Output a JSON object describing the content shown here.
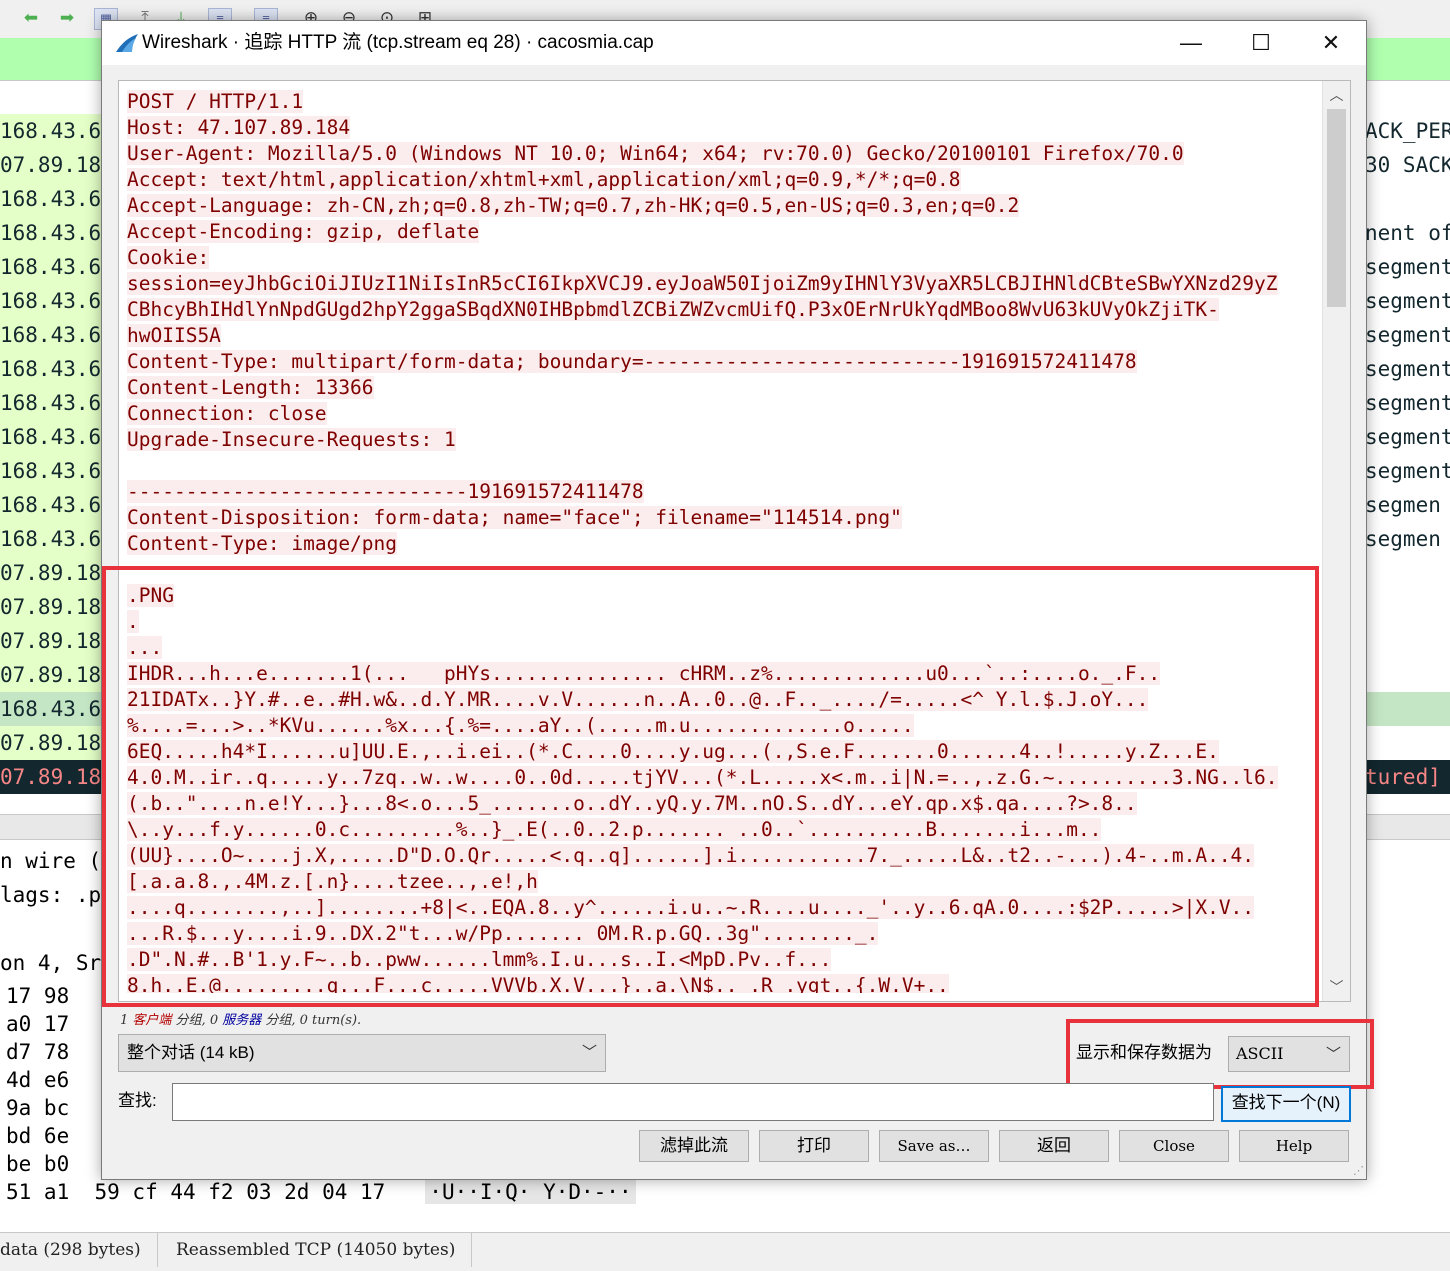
{
  "background": {
    "left_rows": [
      "168.43.6",
      "07.89.18",
      "168.43.6",
      "168.43.6",
      "168.43.6",
      "168.43.6",
      "168.43.6",
      "168.43.6",
      "168.43.6",
      "168.43.6",
      "168.43.6",
      "168.43.6",
      "168.43.6",
      "07.89.18",
      "07.89.18",
      "07.89.18",
      "07.89.18",
      "168.43.6",
      "07.89.18",
      "07.89.18"
    ],
    "right_rows": [
      "ACK_PER",
      "30 SACK",
      "",
      "nent of",
      "segment",
      "segment",
      "segment",
      "segment",
      "segment",
      "segment",
      "segment",
      "segmen",
      "segmen",
      "",
      "",
      "",
      "",
      "",
      "",
      "tured]"
    ],
    "details": [
      "n wire (",
      "lags: .p",
      "",
      "on 4, Sr"
    ],
    "bytes_left": [
      "17 98",
      "a0 17",
      "d7 78",
      "4d e6",
      "9a bc",
      "bd 6e",
      "be b0"
    ],
    "bytes_bottom_hex": "51 a1  59 cf 44 f2 03 2d 04 17",
    "bytes_bottom_ascii": "·U··I·Q· Y·D·-··",
    "status_frame": "data (298 bytes)",
    "status_reassembled": "Reassembled TCP (14050 bytes)"
  },
  "dialog": {
    "title": "Wireshark · 追踪 HTTP 流 (tcp.stream eq 28) · cacosmia.cap",
    "stream_lines": [
      "POST / HTTP/1.1",
      "Host: 47.107.89.184",
      "User-Agent: Mozilla/5.0 (Windows NT 10.0; Win64; x64; rv:70.0) Gecko/20100101 Firefox/70.0",
      "Accept: text/html,application/xhtml+xml,application/xml;q=0.9,*/*;q=0.8",
      "Accept-Language: zh-CN,zh;q=0.8,zh-TW;q=0.7,zh-HK;q=0.5,en-US;q=0.3,en;q=0.2",
      "Accept-Encoding: gzip, deflate",
      "Cookie:",
      "session=eyJhbGciOiJIUzI1NiIsInR5cCI6IkpXVCJ9.eyJoaW50IjoiZm9yIHNlY3VyaXR5LCBJIHNldCBteSBwYXNzd29yZ",
      "CBhcyBhIHdlYnNpdGUgd2hpY2ggaSBqdXN0IHBpbmdlZCBiZWZvcmUifQ.P3xOErNrUkYqdMBoo8WvU63kUVyOkZjiTK-",
      "hwOIIS5A",
      "Content-Type: multipart/form-data; boundary=---------------------------191691572411478",
      "Content-Length: 13366",
      "Connection: close",
      "Upgrade-Insecure-Requests: 1",
      "",
      "-----------------------------191691572411478",
      "Content-Disposition: form-data; name=\"face\"; filename=\"114514.png\"",
      "Content-Type: image/png",
      "",
      ".PNG",
      ".",
      "...",
      "IHDR...h...e.......1(...   pHYs............... cHRM..z%.............u0...`..:....o._.F..",
      "21IDATx..}Y.#..e..#H.w&..d.Y.MR....v.V......n..A..0..@..F.._..../=.....<^ Y.l.$.J.oY...",
      "%....=...>..*KVu......%x...{.%=....aY..(.....m.u.............o.....",
      "6EQ.....h4*I......u]UU.E.,..i.ei..(*.C....0....y.ug...(.,S.e.F.......0......4..!.....y.Z...E.",
      "4.0.M..ir..q.....y..7zq..w..w....0..0d.....tjYV...(*.L.....x<.m..i|N.=..,.z.G.~..........3.NG..l6.",
      "(.b..\"....n.e!Y...}...8<.o...5_.......o..dY..yQ.y.7M..nO.S..dY...eY.qp.x$.qa....?>.8..",
      "\\..y...f.y......0.c.........%..}_.E(..0..2.p....... ..0..`..........B.......i...m..",
      "(UU}....O~....j.X,.....D\"D.O.Qr.....<.q..q]......].i...........7._.....L&..t2..-...).4-..m.A..4.",
      "[.a.a.8.,.4M.z.[.n}....tzee..,.e!,h",
      "....q........,..]........+8|<..EQA.8..y^......i.u..~.R....u...._'..y..6.qA.0....:$2P.....>|X.V..",
      "...R.$...y....i.9..DX.2\"t...w/Pp....... 0M.R.p.GQ..3g\"........_.",
      ".D\".N.#..B'1.y.F~..b..pww......lmm%.I.u...s..I.<MpD.Pv..f...",
      "8.h..E.@.........q...F...c.....VVVb.X.V...}..a.\\N$.. .R .ygt..{.W.V+.."
    ],
    "stats": {
      "p1": "1 ",
      "client": "客户端",
      "p2": " 分组, 0 ",
      "server": "服务器",
      "p3": " 分组, 0 turn(s)."
    },
    "conversation_select": "整个对话 (14 kB)",
    "show_as_label": "显示和保存数据为",
    "encoding_select": "ASCII",
    "find_label": "查找:",
    "find_value": "",
    "find_next_label": "查找下一个(N)",
    "buttons": {
      "filter_out": "滤掉此流",
      "print": "打印",
      "save_as": "Save as…",
      "back": "返回",
      "close": "Close",
      "help": "Help"
    }
  },
  "colors": {
    "client_text": "#7f0000",
    "client_bg": "#fbeded",
    "highlight_box": "#e8323c",
    "filter_bar": "#afffaf"
  }
}
